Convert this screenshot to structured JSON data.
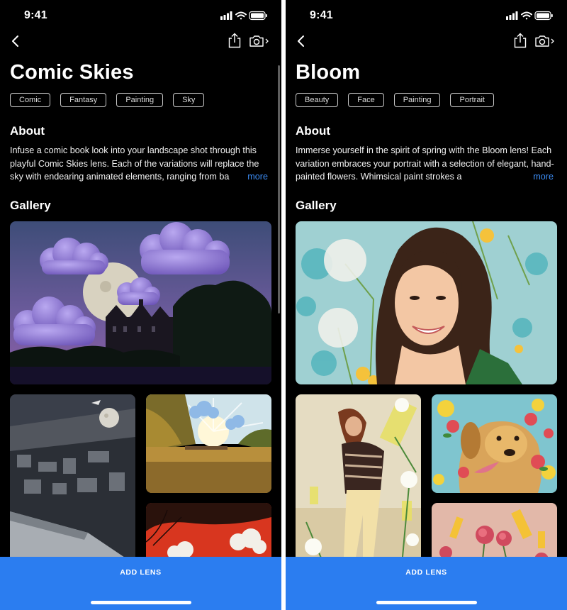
{
  "screens": [
    {
      "status": {
        "time": "9:41"
      },
      "lens": {
        "title": "Comic Skies",
        "tags": [
          "Comic",
          "Fantasy",
          "Painting",
          "Sky"
        ]
      },
      "about": {
        "heading": "About",
        "text": "Infuse a comic book look into your landscape shot through this playful Comic Skies lens. Each of the variations will replace the sky with endearing animated elements, ranging from ba",
        "more_label": "more"
      },
      "gallery": {
        "heading": "Gallery",
        "images": [
          "castle-clouds-moon",
          "city-aerial-moon",
          "lake-autumn-clouds",
          "red-sky-clouds"
        ]
      },
      "add_lens_label": "ADD LENS",
      "icons": [
        "signal-icon",
        "wifi-icon",
        "battery-icon",
        "back-icon",
        "share-icon",
        "camera-icon"
      ]
    },
    {
      "status": {
        "time": "9:41"
      },
      "lens": {
        "title": "Bloom",
        "tags": [
          "Beauty",
          "Face",
          "Painting",
          "Portrait"
        ]
      },
      "about": {
        "heading": "About",
        "text": "Immerse yourself in the spirit of spring with the Bloom lens! Each variation embraces your portrait with a selection of elegant, hand-painted flowers. Whimsical paint strokes a",
        "more_label": "more"
      },
      "gallery": {
        "heading": "Gallery",
        "images": [
          "portrait-dandelions",
          "woman-lilies",
          "dog-roses",
          "pink-roses"
        ]
      },
      "add_lens_label": "ADD LENS",
      "icons": [
        "signal-icon",
        "wifi-icon",
        "battery-icon",
        "back-icon",
        "share-icon",
        "camera-icon"
      ]
    }
  ],
  "colors": {
    "background": "#000000",
    "accent": "#2b7df0",
    "link": "#3c8cf3",
    "tag_border": "#c9c9c9"
  }
}
